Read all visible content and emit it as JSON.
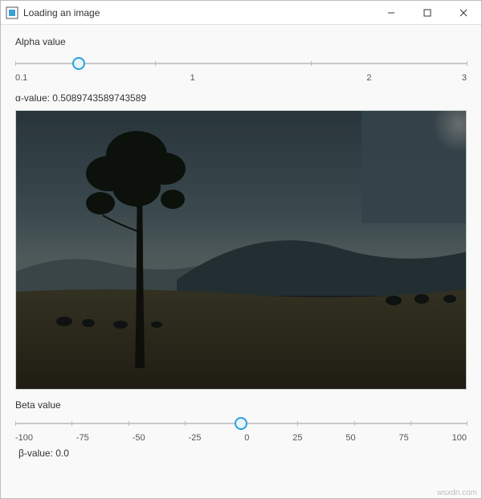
{
  "window": {
    "title": "Loading an image"
  },
  "alpha": {
    "label": "Alpha value",
    "min": 0.1,
    "max": 3,
    "ticks": [
      "0.1",
      "1",
      "2",
      "3"
    ],
    "value": 0.5089743589743589,
    "value_text": "α-value: 0.5089743589743589"
  },
  "beta": {
    "label": "Beta value",
    "min": -100,
    "max": 100,
    "ticks": [
      "-100",
      "-75",
      "-50",
      "-25",
      "0",
      "25",
      "50",
      "75",
      "100"
    ],
    "value": 0.0,
    "value_text": "β-value: 0.0"
  },
  "watermark": "wsxdn.com"
}
